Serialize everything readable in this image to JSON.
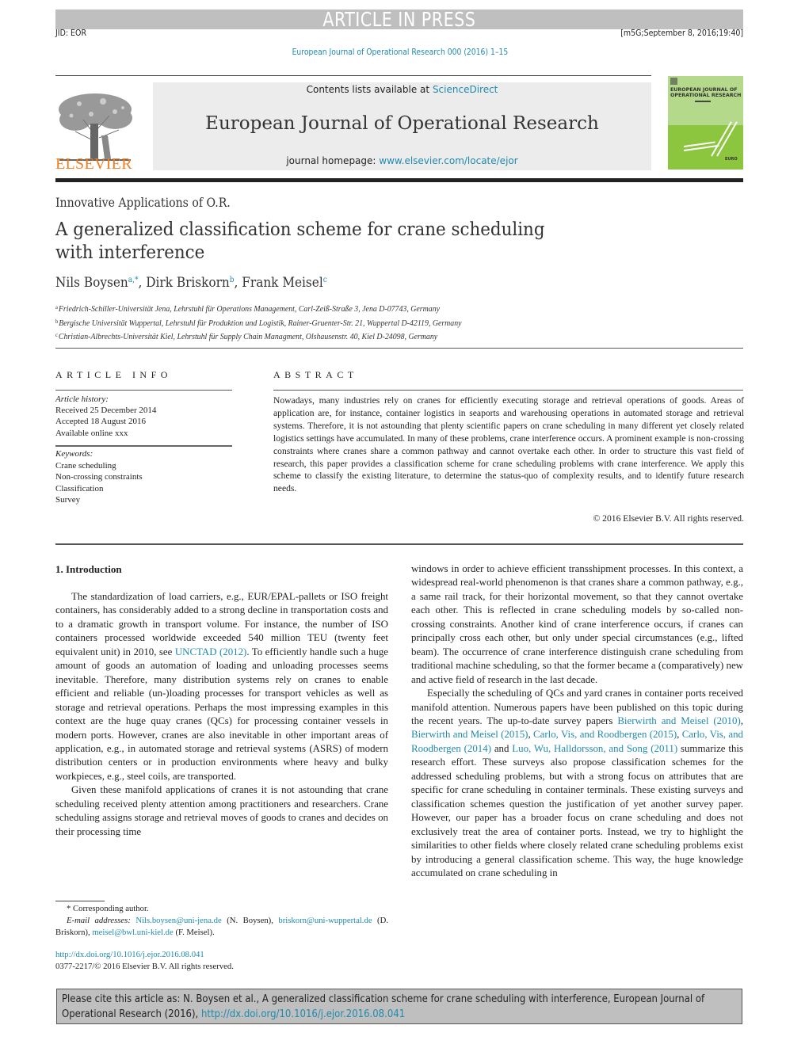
{
  "header": {
    "banner": "ARTICLE IN PRESS",
    "jid": "JID: EOR",
    "stamp": "[m5G;September 8, 2016;19:40]",
    "journal_ref": "European Journal of Operational Research 000 (2016) 1–15"
  },
  "masthead": {
    "publisher_logo_word": "ELSEVIER",
    "contents_prefix": "Contents lists available at ",
    "contents_link": "ScienceDirect",
    "journal_title": "European Journal of Operational Research",
    "homepage_prefix": "journal homepage: ",
    "homepage_link": "www.elsevier.com/locate/ejor",
    "cover": {
      "title_line1": "EUROPEAN JOURNAL OF",
      "title_line2": "OPERATIONAL RESEARCH",
      "badge": "EURO",
      "bg_color": "#8cc63f"
    }
  },
  "article": {
    "section_type": "Innovative Applications of O.R.",
    "title": "A generalized classification scheme for crane scheduling with interference",
    "authors": [
      {
        "name": "Nils Boysen",
        "marks": "a,*"
      },
      {
        "name": "Dirk Briskorn",
        "marks": "b"
      },
      {
        "name": "Frank Meisel",
        "marks": "c"
      }
    ],
    "affiliations": [
      {
        "mark": "a",
        "text": "Friedrich-Schiller-Universität Jena, Lehrstuhl für Operations Management, Carl-Zeiß-Straße 3, Jena D-07743, Germany"
      },
      {
        "mark": "b",
        "text": "Bergische Universität Wuppertal, Lehrstuhl für Produktion und Logistik, Rainer-Gruenter-Str. 21, Wuppertal D-42119, Germany"
      },
      {
        "mark": "c",
        "text": "Christian-Albrechts-Universität Kiel, Lehrstuhl für Supply Chain Managment, Olshausenstr. 40, Kiel D-24098, Germany"
      }
    ]
  },
  "article_info": {
    "heading": "ARTICLE INFO",
    "history_label": "Article history:",
    "history": [
      "Received 25 December 2014",
      "Accepted 18 August 2016",
      "Available online xxx"
    ],
    "keywords_label": "Keywords:",
    "keywords": [
      "Crane scheduling",
      "Non-crossing constraints",
      "Classification",
      "Survey"
    ]
  },
  "abstract": {
    "heading": "ABSTRACT",
    "text": "Nowadays, many industries rely on cranes for efficiently executing storage and retrieval operations of goods. Areas of application are, for instance, container logistics in seaports and warehousing operations in automated storage and retrieval systems. Therefore, it is not astounding that plenty scientific papers on crane scheduling in many different yet closely related logistics settings have accumulated. In many of these problems, crane interference occurs. A prominent example is non-crossing constraints where cranes share a common pathway and cannot overtake each other. In order to structure this vast field of research, this paper provides a classification scheme for crane scheduling problems with crane interference. We apply this scheme to classify the existing literature, to determine the status-quo of complexity results, and to identify future research needs.",
    "copyright": "© 2016 Elsevier B.V. All rights reserved."
  },
  "body": {
    "section_heading": "1. Introduction",
    "left_p1_a": "The standardization of load carriers, e.g., EUR/EPAL-pallets or ISO freight containers, has considerably added to a strong decline in transportation costs and to a dramatic growth in transport volume. For instance, the number of ISO containers processed worldwide exceeded 540 million TEU (twenty feet equivalent unit) in 2010, see ",
    "left_p1_link": "UNCTAD (2012)",
    "left_p1_b": ". To efficiently handle such a huge amount of goods an automation of loading and unloading processes seems inevitable. Therefore, many distribution systems rely on cranes to enable efficient and reliable (un-)loading processes for transport vehicles as well as storage and retrieval operations. Perhaps the most impressing examples in this context are the huge quay cranes (QCs) for processing container vessels in modern ports. However, cranes are also inevitable in other important areas of application, e.g., in automated storage and retrieval systems (ASRS) of modern distribution centers or in production environments where heavy and bulky workpieces, e.g., steel coils, are transported.",
    "left_p2": "Given these manifold applications of cranes it is not astounding that crane scheduling received plenty attention among practitioners and researchers. Crane scheduling assigns storage and retrieval moves of goods to cranes and decides on their processing time",
    "right_p1": "windows in order to achieve efficient transshipment processes. In this context, a widespread real-world phenomenon is that cranes share a common pathway, e.g., a same rail track, for their horizontal movement, so that they cannot overtake each other. This is reflected in crane scheduling models by so-called non-crossing constraints. Another kind of crane interference occurs, if cranes can principally cross each other, but only under special circumstances (e.g., lifted beam). The occurrence of crane interference distinguish crane scheduling from traditional machine scheduling, so that the former became a (comparatively) new and active field of research in the last decade.",
    "right_p2_a": "Especially the scheduling of QCs and yard cranes in container ports received manifold attention. Numerous papers have been published on this topic during the recent years. The up-to-date survey papers ",
    "right_p2_refs": [
      "Bierwirth and Meisel (2010)",
      "Bierwirth and Meisel (2015)",
      "Carlo, Vis, and Roodbergen (2015)",
      "Carlo, Vis, and Roodbergen (2014)",
      "Luo, Wu, Halldorsson, and Song (2011)"
    ],
    "right_p2_sep1": ", ",
    "right_p2_sep2": ", ",
    "right_p2_sep3": ", ",
    "right_p2_sep4": " and ",
    "right_p2_b": " summarize this research effort. These surveys also propose classification schemes for the addressed scheduling problems, but with a strong focus on attributes that are specific for crane scheduling in container terminals. These existing surveys and classification schemes question the justification of yet another survey paper. However, our paper has a broader focus on crane scheduling and does not exclusively treat the area of container ports. Instead, we try to highlight the similarities to other fields where closely related crane scheduling problems exist by introducing a general classification scheme. This way, the huge knowledge accumulated on crane scheduling in"
  },
  "footnotes": {
    "corresponding": "* Corresponding author.",
    "email_label": "E-mail addresses:",
    "emails": [
      {
        "address": "Nils.boysen@uni-jena.de",
        "owner": " (N. Boysen), "
      },
      {
        "address": "briskorn@uni-wuppertal.de",
        "owner": " (D. Briskorn), "
      },
      {
        "address": "meisel@bwl.uni-kiel.de",
        "owner": " (F. Meisel)."
      }
    ],
    "doi_link": "http://dx.doi.org/10.1016/j.ejor.2016.08.041",
    "issn_line": "0377-2217/© 2016 Elsevier B.V. All rights reserved."
  },
  "citation_box": {
    "text": "Please cite this article as: N. Boysen et al., A generalized classification scheme for crane scheduling with interference, European Journal of Operational Research (2016), ",
    "link": "http://dx.doi.org/10.1016/j.ejor.2016.08.041"
  },
  "colors": {
    "link": "#1f8aae",
    "elsevier_orange": "#f07e1f",
    "banner_gray": "#bfbfbf",
    "masthead_gray": "#ececec"
  }
}
